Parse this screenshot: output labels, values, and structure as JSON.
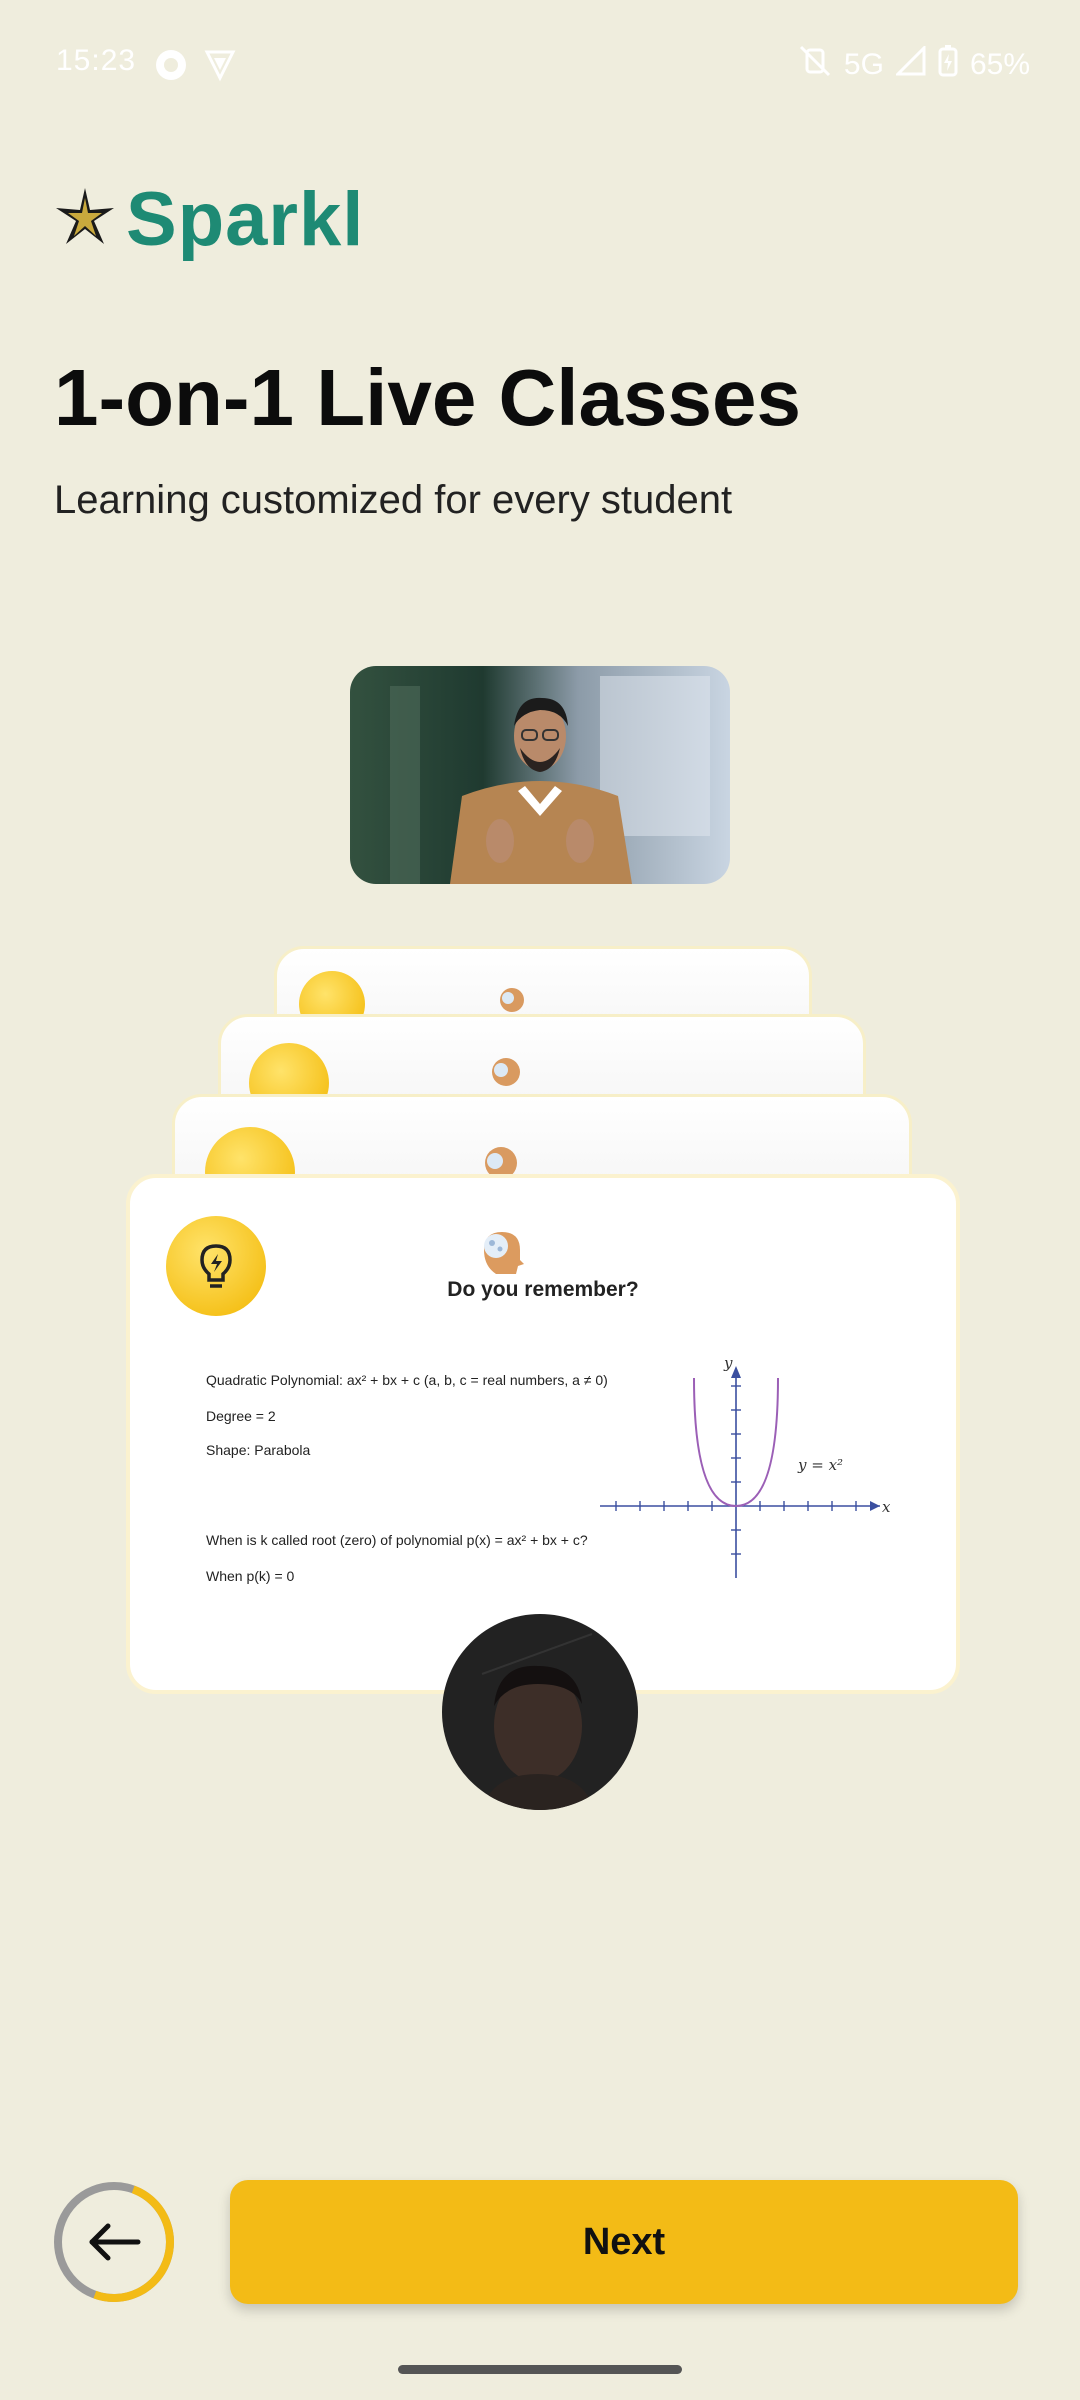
{
  "status_bar": {
    "time": "15:23",
    "network": "5G",
    "battery": "65%",
    "icons": [
      "record-icon",
      "vpn-shield-icon",
      "vibrate-off-icon",
      "signal-icon",
      "battery-icon"
    ]
  },
  "brand": {
    "name": "Sparkl",
    "color": "#1E8A74"
  },
  "hero": {
    "title": "1-on-1 Live Classes",
    "subtitle": "Learning customized for every student"
  },
  "lesson_card": {
    "heading": "Do you remember?",
    "lines": [
      "Quadratic Polynomial: ax² + bx + c   (a, b, c = real numbers, a ≠ 0)",
      "Degree = 2",
      "Shape: Parabola",
      "When is k called root (zero) of polynomial p(x) = ax² + bx + c?",
      "When p(k) = 0"
    ],
    "graph": {
      "x_label": "x",
      "y_label": "y",
      "curve_label": "y = x²"
    }
  },
  "footer": {
    "next_label": "Next",
    "progress_fraction": 0.5,
    "accent": "#F3BB16"
  }
}
